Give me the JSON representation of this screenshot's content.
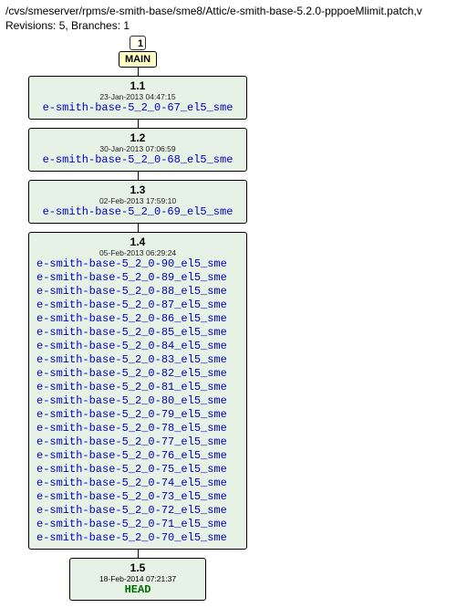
{
  "header": {
    "path": "/cvs/smeserver/rpms/e-smith-base/sme8/Attic/e-smith-base-5.2.0-pppoeMlimit.patch,v",
    "meta": "Revisions: 5, Branches: 1"
  },
  "main": {
    "badge": "1",
    "label": "MAIN"
  },
  "revisions": [
    {
      "ver": "1.1",
      "date": "23-Jan-2013 04:47:15",
      "lines": [
        "e-smith-base-5_2_0-67_el5_sme"
      ]
    },
    {
      "ver": "1.2",
      "date": "30-Jan-2013 07:06:59",
      "lines": [
        "e-smith-base-5_2_0-68_el5_sme"
      ]
    },
    {
      "ver": "1.3",
      "date": "02-Feb-2013 17:59:10",
      "lines": [
        "e-smith-base-5_2_0-69_el5_sme"
      ]
    },
    {
      "ver": "1.4",
      "date": "05-Feb-2013 06:29:24",
      "lines": [
        "e-smith-base-5_2_0-90_el5_sme",
        "e-smith-base-5_2_0-89_el5_sme",
        "e-smith-base-5_2_0-88_el5_sme",
        "e-smith-base-5_2_0-87_el5_sme",
        "e-smith-base-5_2_0-86_el5_sme",
        "e-smith-base-5_2_0-85_el5_sme",
        "e-smith-base-5_2_0-84_el5_sme",
        "e-smith-base-5_2_0-83_el5_sme",
        "e-smith-base-5_2_0-82_el5_sme",
        "e-smith-base-5_2_0-81_el5_sme",
        "e-smith-base-5_2_0-80_el5_sme",
        "e-smith-base-5_2_0-79_el5_sme",
        "e-smith-base-5_2_0-78_el5_sme",
        "e-smith-base-5_2_0-77_el5_sme",
        "e-smith-base-5_2_0-76_el5_sme",
        "e-smith-base-5_2_0-75_el5_sme",
        "e-smith-base-5_2_0-74_el5_sme",
        "e-smith-base-5_2_0-73_el5_sme",
        "e-smith-base-5_2_0-72_el5_sme",
        "e-smith-base-5_2_0-71_el5_sme",
        "e-smith-base-5_2_0-70_el5_sme"
      ]
    }
  ],
  "head": {
    "ver": "1.5",
    "date": "18-Feb-2014 07:21:37",
    "tag": "HEAD"
  }
}
